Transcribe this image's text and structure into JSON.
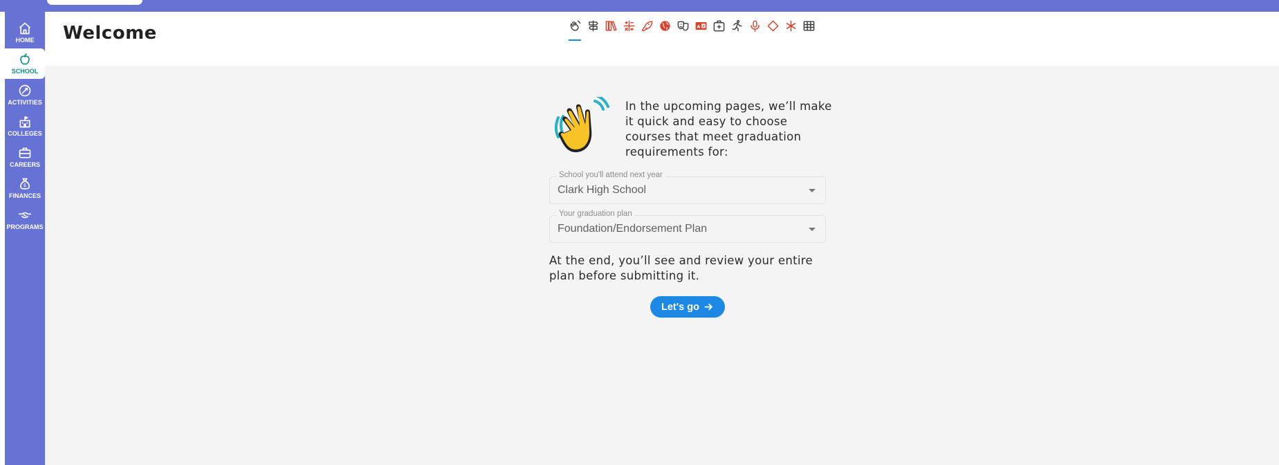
{
  "sidebar": {
    "items": [
      {
        "label": "HOME",
        "icon": "home-icon"
      },
      {
        "label": "SCHOOL",
        "icon": "apple-icon",
        "active": true
      },
      {
        "label": "ACTIVITIES",
        "icon": "activities-icon"
      },
      {
        "label": "COLLEGES",
        "icon": "college-building-icon"
      },
      {
        "label": "CAREERS",
        "icon": "briefcase-icon"
      },
      {
        "label": "FINANCES",
        "icon": "money-bag-icon"
      },
      {
        "label": "PROGRAMS",
        "icon": "handshake-icon"
      }
    ]
  },
  "header": {
    "title": "Welcome",
    "steps": [
      {
        "icon": "waving-hand-icon",
        "active": true
      },
      {
        "icon": "sign-post-icon"
      },
      {
        "icon": "books-icon"
      },
      {
        "icon": "math-symbols-icon"
      },
      {
        "icon": "rocket-icon"
      },
      {
        "icon": "globe-icon"
      },
      {
        "icon": "theater-masks-icon"
      },
      {
        "icon": "language-card-icon"
      },
      {
        "icon": "first-aid-kit-icon"
      },
      {
        "icon": "running-person-icon"
      },
      {
        "icon": "microphone-icon"
      },
      {
        "icon": "diamond-icon"
      },
      {
        "icon": "asterisk-icon"
      },
      {
        "icon": "grid-table-icon"
      }
    ]
  },
  "main": {
    "intro_text": "In the upcoming pages, we’ll make it quick and easy to choose courses that meet graduation requirements for:",
    "school_field": {
      "label": "School you'll attend next year",
      "value": "Clark High School"
    },
    "plan_field": {
      "label": "Your graduation plan",
      "value": "Foundation/Endorsement Plan"
    },
    "end_text": "At the end, you’ll see and review your entire plan before submitting it.",
    "button_label": "Let's go"
  },
  "colors": {
    "sidebar": "#6672d4",
    "active_label": "#0f8c86",
    "step_dark": "#3d3d3d",
    "step_red": "#d9422e",
    "primary_button": "#1e88e5",
    "background": "#f4f4f4"
  }
}
